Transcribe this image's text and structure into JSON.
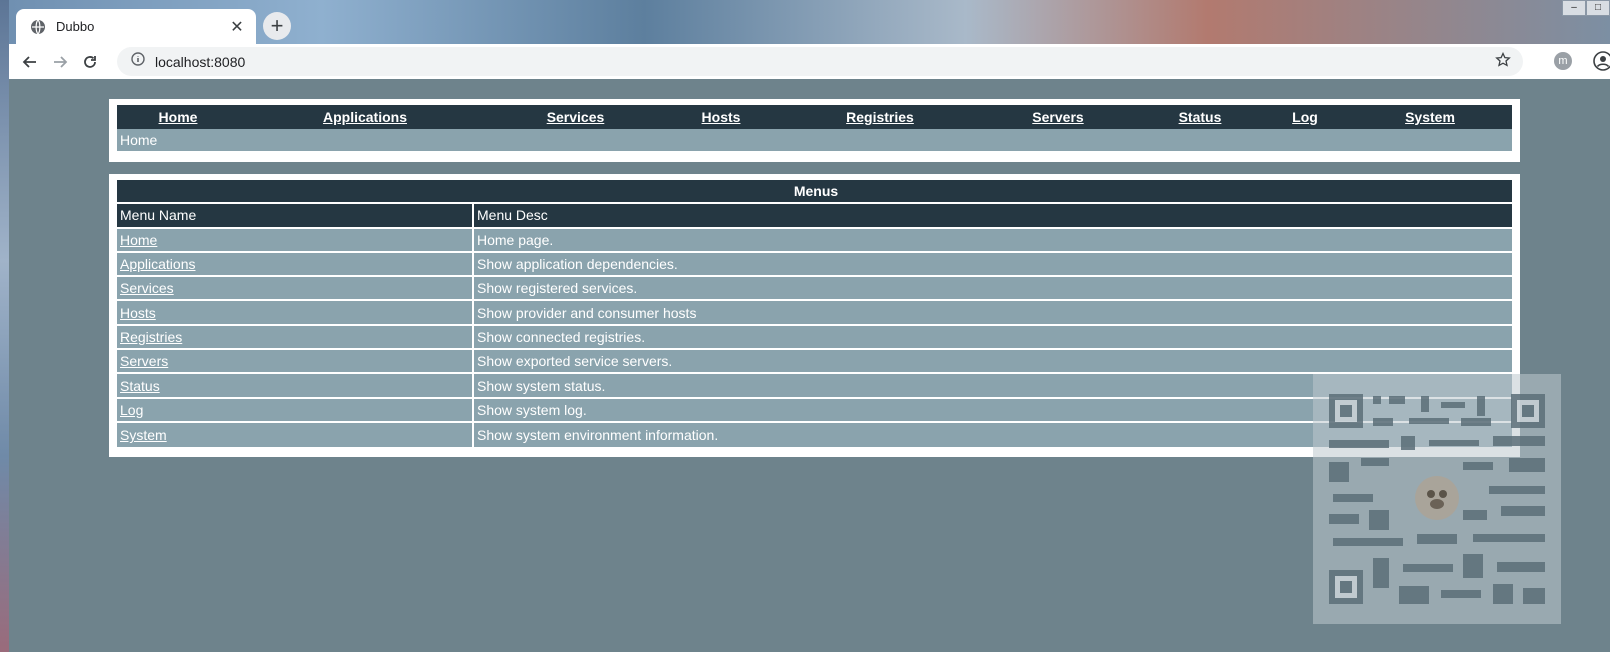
{
  "browser": {
    "tab_title": "Dubbo",
    "url": "localhost:8080",
    "extension_letter": "m"
  },
  "nav": {
    "items": [
      "Home",
      "Applications",
      "Services",
      "Hosts",
      "Registries",
      "Servers",
      "Status",
      "Log",
      "System"
    ],
    "breadcrumb": "Home"
  },
  "menus": {
    "title": "Menus",
    "headers": [
      "Menu Name",
      "Menu Desc"
    ],
    "rows": [
      {
        "name": "Home",
        "desc": "Home page."
      },
      {
        "name": "Applications",
        "desc": "Show application dependencies."
      },
      {
        "name": "Services",
        "desc": "Show registered services."
      },
      {
        "name": "Hosts",
        "desc": "Show provider and consumer hosts"
      },
      {
        "name": "Registries",
        "desc": "Show connected registries."
      },
      {
        "name": "Servers",
        "desc": "Show exported service servers."
      },
      {
        "name": "Status",
        "desc": "Show system status."
      },
      {
        "name": "Log",
        "desc": "Show system log."
      },
      {
        "name": "System",
        "desc": "Show system environment information."
      }
    ]
  },
  "colors": {
    "page_bg": "#6e838c",
    "header_bg": "#253742",
    "row_bg": "#8aa3ad"
  }
}
